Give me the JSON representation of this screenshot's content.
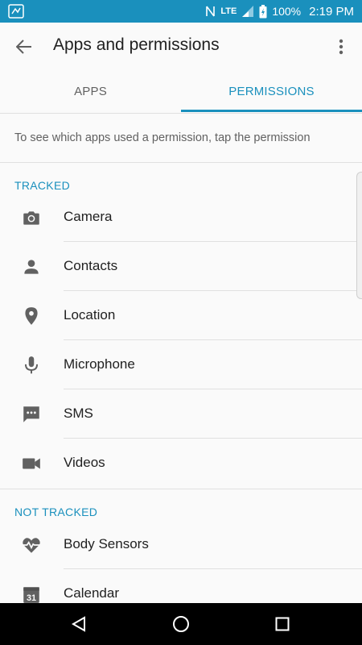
{
  "status_bar": {
    "network": "LTE",
    "battery": "100%",
    "time": "2:19 PM"
  },
  "app_bar": {
    "title": "Apps and permissions",
    "back_icon": "arrow-back-icon",
    "overflow_icon": "more-vert-icon"
  },
  "tabs": [
    {
      "label": "APPS",
      "selected": false
    },
    {
      "label": "PERMISSIONS",
      "selected": true
    }
  ],
  "hint": "To see which apps used a permission, tap the permission",
  "sections": {
    "tracked": {
      "header": "TRACKED",
      "items": [
        {
          "label": "Camera",
          "icon": "camera-icon"
        },
        {
          "label": "Contacts",
          "icon": "person-icon"
        },
        {
          "label": "Location",
          "icon": "location-pin-icon"
        },
        {
          "label": "Microphone",
          "icon": "microphone-icon"
        },
        {
          "label": "SMS",
          "icon": "sms-icon"
        },
        {
          "label": "Videos",
          "icon": "videocam-icon"
        }
      ]
    },
    "not_tracked": {
      "header": "NOT TRACKED",
      "items": [
        {
          "label": "Body Sensors",
          "icon": "heart-pulse-icon"
        },
        {
          "label": "Calendar",
          "icon": "calendar-icon",
          "icon_text": "31"
        }
      ]
    }
  },
  "colors": {
    "accent": "#1a90bd",
    "background": "#fafafa",
    "icon": "#616161"
  }
}
